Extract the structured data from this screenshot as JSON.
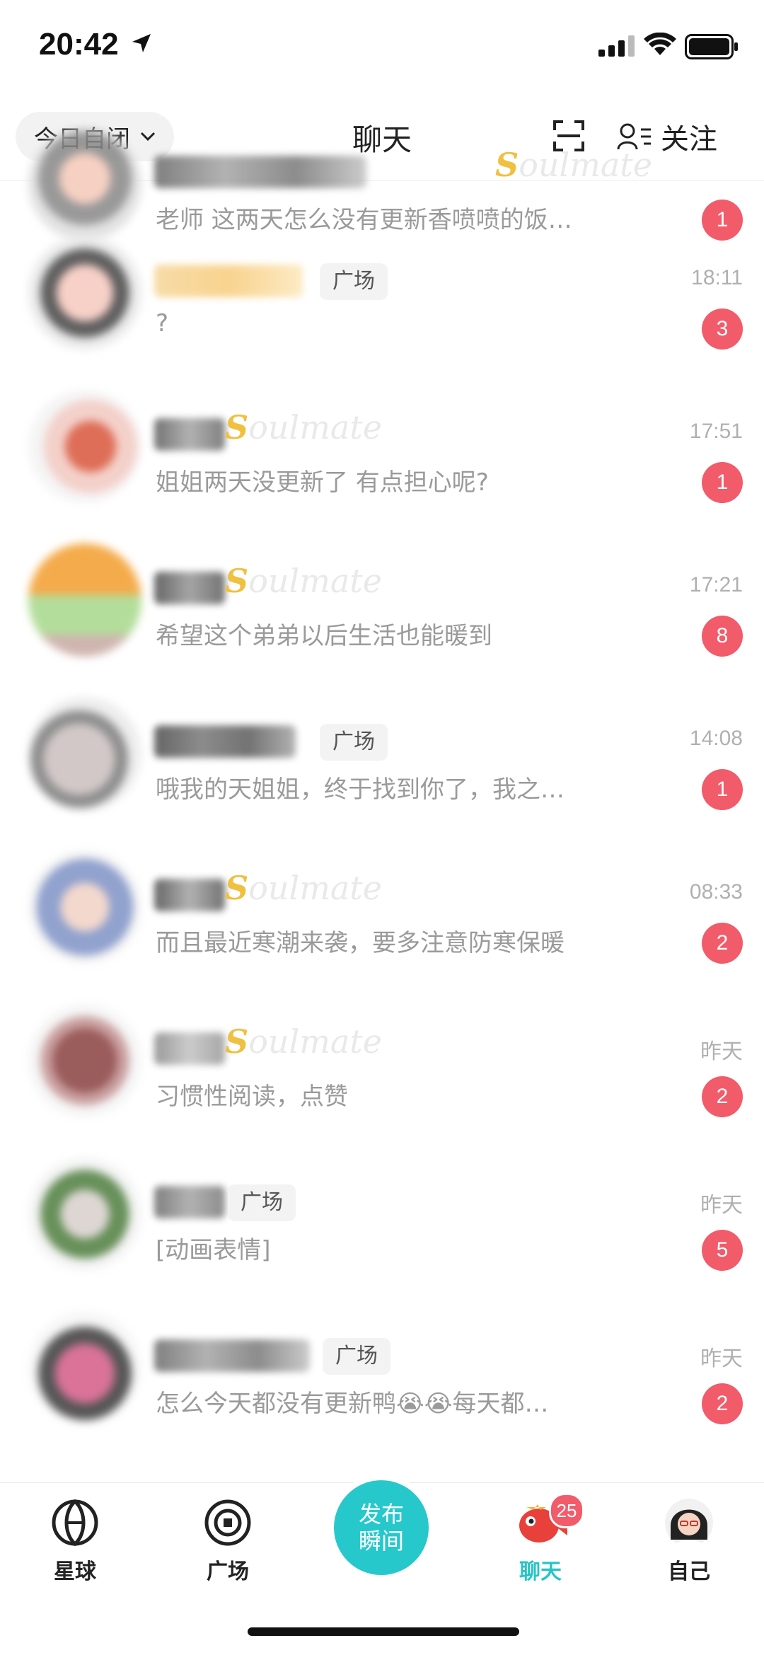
{
  "status_bar": {
    "time": "20:42"
  },
  "header": {
    "mood": "今日自闭",
    "title": "聊天",
    "follow_label": "关注"
  },
  "chats": [
    {
      "tag": "",
      "soulmate": "Soulmate",
      "time": "",
      "message": "老师 这两天怎么没有更新香喷喷的饭…",
      "unread": "1"
    },
    {
      "tag": "广场",
      "soulmate": "",
      "time": "18:11",
      "message": "?",
      "unread": "3"
    },
    {
      "tag": "",
      "soulmate": "Soulmate",
      "time": "17:51",
      "message": "姐姐两天没更新了 有点担心呢?",
      "unread": "1"
    },
    {
      "tag": "",
      "soulmate": "Soulmate",
      "time": "17:21",
      "message": "希望这个弟弟以后生活也能暖到",
      "unread": "8"
    },
    {
      "tag": "广场",
      "soulmate": "",
      "time": "14:08",
      "message": "哦我的天姐姐，终于找到你了，我之…",
      "unread": "1"
    },
    {
      "tag": "",
      "soulmate": "Soulmate",
      "time": "08:33",
      "message": "而且最近寒潮来袭，要多注意防寒保暖",
      "unread": "2"
    },
    {
      "tag": "",
      "soulmate": "Soulmate",
      "time": "昨天",
      "message": "习惯性阅读，点赞",
      "unread": "2"
    },
    {
      "tag": "广场",
      "soulmate": "",
      "time": "昨天",
      "message": "[动画表情]",
      "unread": "5"
    },
    {
      "tag": "广场",
      "soulmate": "",
      "time": "昨天",
      "message": "怎么今天都没有更新鸭😭😭每天都…",
      "unread": "2"
    }
  ],
  "tabbar": {
    "planet": "星球",
    "square": "广场",
    "publish_line1": "发布",
    "publish_line2": "瞬间",
    "chat": "聊天",
    "chat_badge": "25",
    "me": "自己"
  },
  "colors": {
    "accent": "#27c8cc",
    "badge": "#f25b6a",
    "soulmate_s": "#f0c040"
  }
}
